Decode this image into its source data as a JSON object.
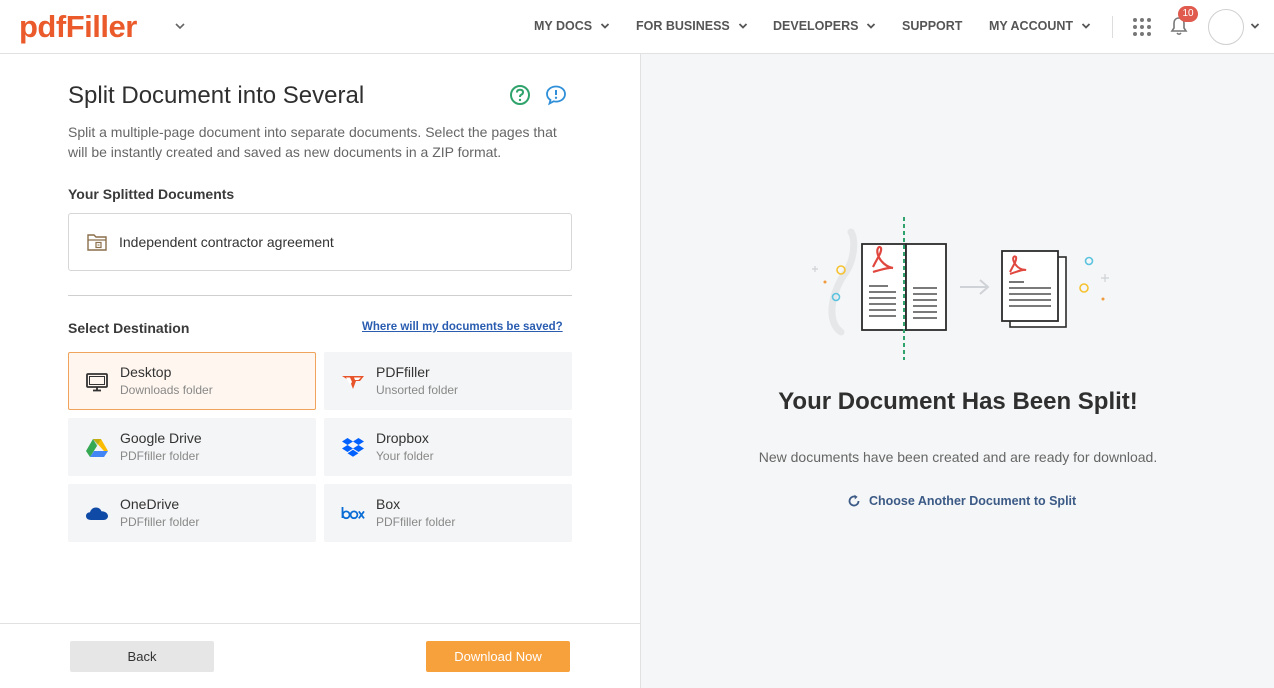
{
  "header": {
    "logo": "pdfFiller",
    "nav": [
      {
        "label": "MY DOCS",
        "has_caret": true
      },
      {
        "label": "FOR BUSINESS",
        "has_caret": true
      },
      {
        "label": "DEVELOPERS",
        "has_caret": true
      },
      {
        "label": "SUPPORT",
        "has_caret": false
      },
      {
        "label": "MY ACCOUNT",
        "has_caret": true
      }
    ],
    "notifications_count": "10"
  },
  "left": {
    "title": "Split Document into Several",
    "description": "Split a multiple-page document into separate documents. Select the pages that will be instantly created and saved as new documents in a ZIP format.",
    "split_docs_label": "Your Splitted Documents",
    "document_name": "Independent contractor agreement",
    "destination_label": "Select Destination",
    "where_link": "Where will my documents be saved?",
    "destinations": [
      {
        "name": "Desktop",
        "sub": "Downloads folder",
        "icon": "monitor-icon",
        "selected": true
      },
      {
        "name": "PDFfiller",
        "sub": "Unsorted folder",
        "icon": "pdffiller-icon",
        "selected": false
      },
      {
        "name": "Google Drive",
        "sub": "PDFfiller folder",
        "icon": "google-drive-icon",
        "selected": false
      },
      {
        "name": "Dropbox",
        "sub": "Your folder",
        "icon": "dropbox-icon",
        "selected": false
      },
      {
        "name": "OneDrive",
        "sub": "PDFfiller folder",
        "icon": "onedrive-icon",
        "selected": false
      },
      {
        "name": "Box",
        "sub": "PDFfiller folder",
        "icon": "box-icon",
        "selected": false
      }
    ],
    "back_label": "Back",
    "download_label": "Download Now"
  },
  "right": {
    "title": "Your Document Has Been Split!",
    "description": "New documents have been created and are ready for download.",
    "another_link": "Choose Another Document to Split"
  },
  "colors": {
    "brand": "#ea5a2b",
    "accent_orange": "#f7a13d",
    "link_blue": "#2a5db0",
    "badge_red": "#e05a4e"
  }
}
